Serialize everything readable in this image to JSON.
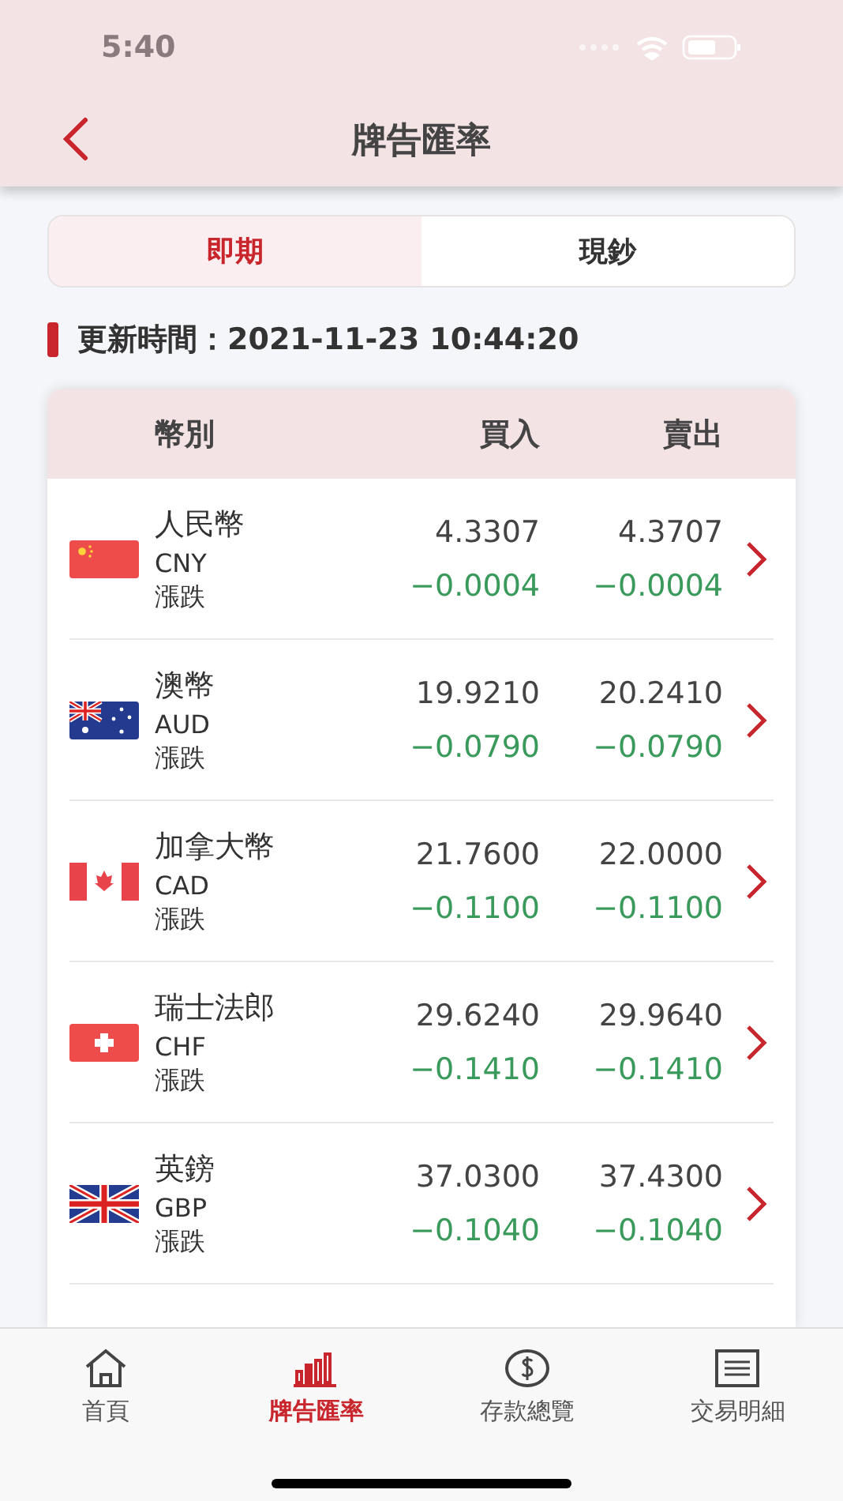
{
  "status_bar": {
    "time": "5:40"
  },
  "header": {
    "title": "牌告匯率"
  },
  "segments": [
    {
      "label": "即期",
      "selected": true
    },
    {
      "label": "現鈔",
      "selected": false
    }
  ],
  "update": {
    "label": "更新時間：2021-11-23 10:44:20"
  },
  "table": {
    "columns": [
      "幣別",
      "買入",
      "賣出"
    ],
    "rows": [
      {
        "name": "人民幣",
        "code": "CNY",
        "change_label": "漲跌",
        "buy": "4.3307",
        "sell": "4.3707",
        "buy_change": "−0.0004",
        "sell_change": "−0.0004"
      },
      {
        "name": "澳幣",
        "code": "AUD",
        "change_label": "漲跌",
        "buy": "19.9210",
        "sell": "20.2410",
        "buy_change": "−0.0790",
        "sell_change": "−0.0790"
      },
      {
        "name": "加拿大幣",
        "code": "CAD",
        "change_label": "漲跌",
        "buy": "21.7600",
        "sell": "22.0000",
        "buy_change": "−0.1100",
        "sell_change": "−0.1100"
      },
      {
        "name": "瑞士法郎",
        "code": "CHF",
        "change_label": "漲跌",
        "buy": "29.6240",
        "sell": "29.9640",
        "buy_change": "−0.1410",
        "sell_change": "−0.1410"
      },
      {
        "name": "英鎊",
        "code": "GBP",
        "change_label": "漲跌",
        "buy": "37.0300",
        "sell": "37.4300",
        "buy_change": "−0.1040",
        "sell_change": "−0.1040"
      }
    ]
  },
  "tab_bar": [
    {
      "label": "首頁",
      "selected": false
    },
    {
      "label": "牌告匯率",
      "selected": true
    },
    {
      "label": "存款總覽",
      "selected": false
    },
    {
      "label": "交易明細",
      "selected": false
    }
  ]
}
